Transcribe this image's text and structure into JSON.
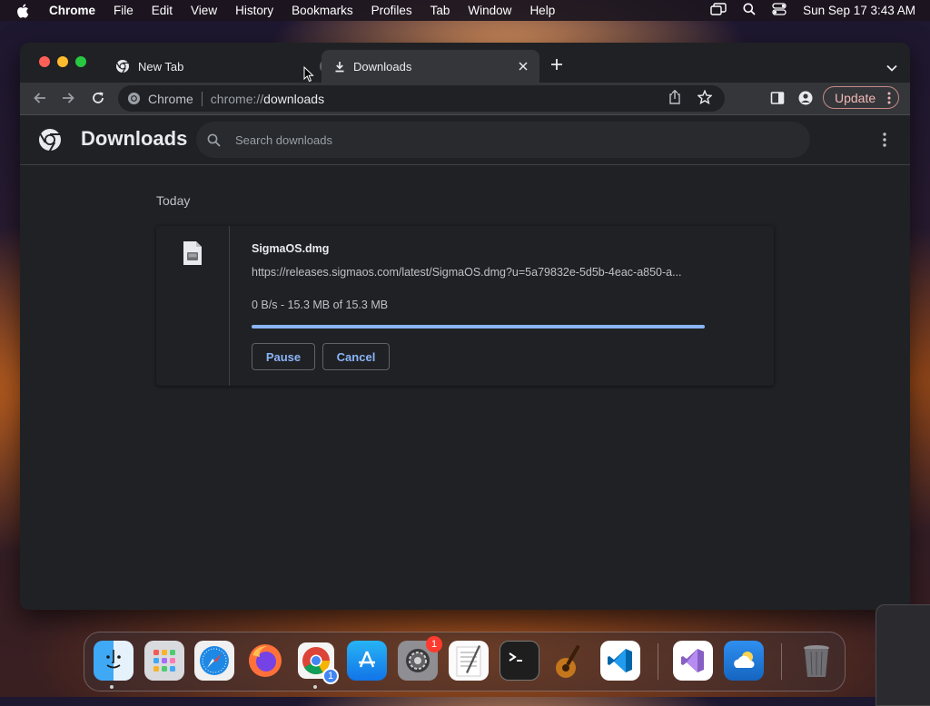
{
  "menubar": {
    "app_name": "Chrome",
    "items": [
      "File",
      "Edit",
      "View",
      "History",
      "Bookmarks",
      "Profiles",
      "Tab",
      "Window",
      "Help"
    ],
    "clock": "Sun Sep 17  3:43 AM"
  },
  "tabs": [
    {
      "title": "New Tab",
      "icon": "chrome-logo-icon"
    },
    {
      "title": "Downloads",
      "icon": "download-icon",
      "active": true
    }
  ],
  "toolbar": {
    "chip": "Chrome",
    "url_prefix": "chrome://",
    "url_path": "downloads",
    "update_label": "Update"
  },
  "page": {
    "title": "Downloads",
    "search_placeholder": "Search downloads"
  },
  "downloads": {
    "section_date": "Today",
    "items": [
      {
        "file_name": "SigmaOS.dmg",
        "url": "https://releases.sigmaos.com/latest/SigmaOS.dmg?u=5a79832e-5d5b-4eac-a850-a...",
        "status": "0 B/s - 15.3 MB of 15.3 MB",
        "progress": 1.0,
        "pause_label": "Pause",
        "cancel_label": "Cancel"
      }
    ]
  },
  "dock": {
    "apps": [
      "finder",
      "launchpad",
      "safari",
      "firefox",
      "chrome",
      "app-store",
      "system-settings",
      "textedit",
      "terminal",
      "garageband",
      "vscode",
      "visual-studio",
      "weather",
      "trash"
    ],
    "system_settings_badge": "1",
    "chrome_badge": "1"
  },
  "colors": {
    "accent": "#8ab4f8",
    "window_bg": "#202124",
    "toolbar_bg": "#35363a",
    "update_border": "#c58a85"
  }
}
